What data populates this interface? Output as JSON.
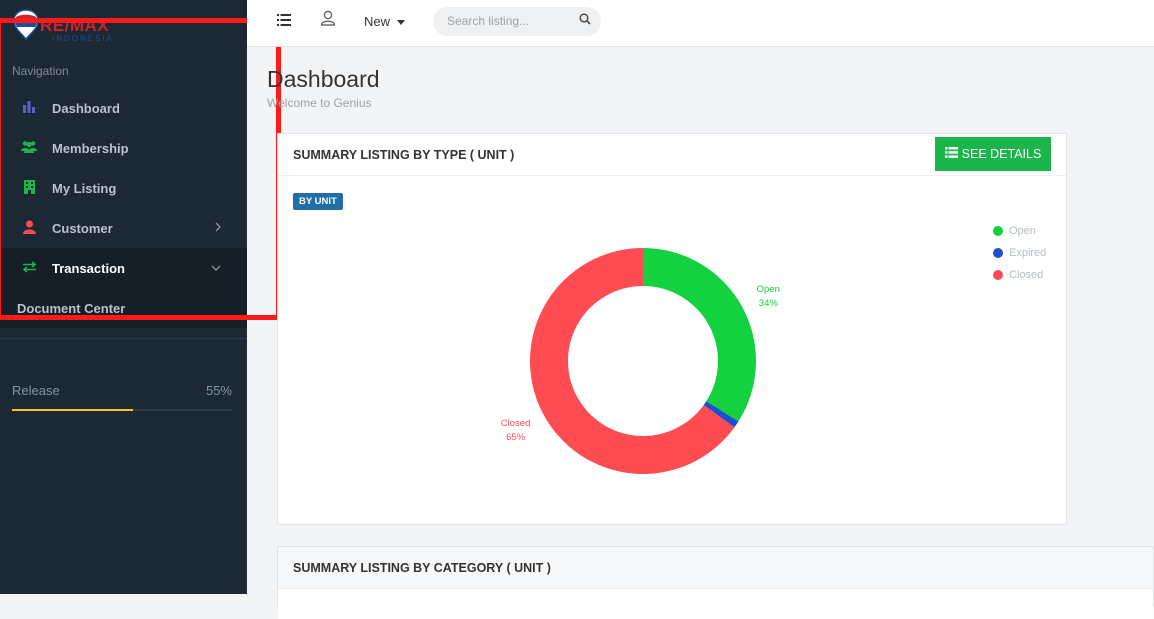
{
  "sidebar": {
    "logo_text": "RE/MAX",
    "logo_sub": "INDONESIA",
    "nav_label": "Navigation",
    "items": [
      {
        "label": "Dashboard",
        "icon": "bar-chart-icon",
        "color": "#5b5fc7"
      },
      {
        "label": "Membership",
        "icon": "users-icon",
        "color": "#1bb54c"
      },
      {
        "label": "My Listing",
        "icon": "building-icon",
        "color": "#1bb54c"
      },
      {
        "label": "Customer",
        "icon": "user-icon",
        "color": "#ff4c52"
      },
      {
        "label": "Transaction",
        "icon": "exchange-icon",
        "color": "#1bb54c"
      }
    ],
    "document_center": "Document Center",
    "release": {
      "label": "Release",
      "value": "55%",
      "fraction": 0.55,
      "color": "#f5c518"
    }
  },
  "topbar": {
    "new_label": "New",
    "search_placeholder": "Search listing..."
  },
  "page": {
    "title": "Dashboard",
    "subtitle": "Welcome to Genius"
  },
  "panel_type": {
    "title": "SUMMARY LISTING BY TYPE ( UNIT )",
    "button": "SEE DETAILS",
    "badge": "BY UNIT"
  },
  "panel_category": {
    "title": "SUMMARY LISTING BY CATEGORY ( UNIT )"
  },
  "chart_data": {
    "type": "pie",
    "categories": [
      "Open",
      "Expired",
      "Closed"
    ],
    "values": [
      34,
      1,
      65
    ],
    "colors": [
      "#13d13f",
      "#1e4fcf",
      "#ff4c52"
    ],
    "data_labels": [
      {
        "name": "Open",
        "value": "34%"
      },
      {
        "name": "Closed",
        "value": "65%"
      }
    ],
    "legend_position": "top-right",
    "donut": true
  }
}
